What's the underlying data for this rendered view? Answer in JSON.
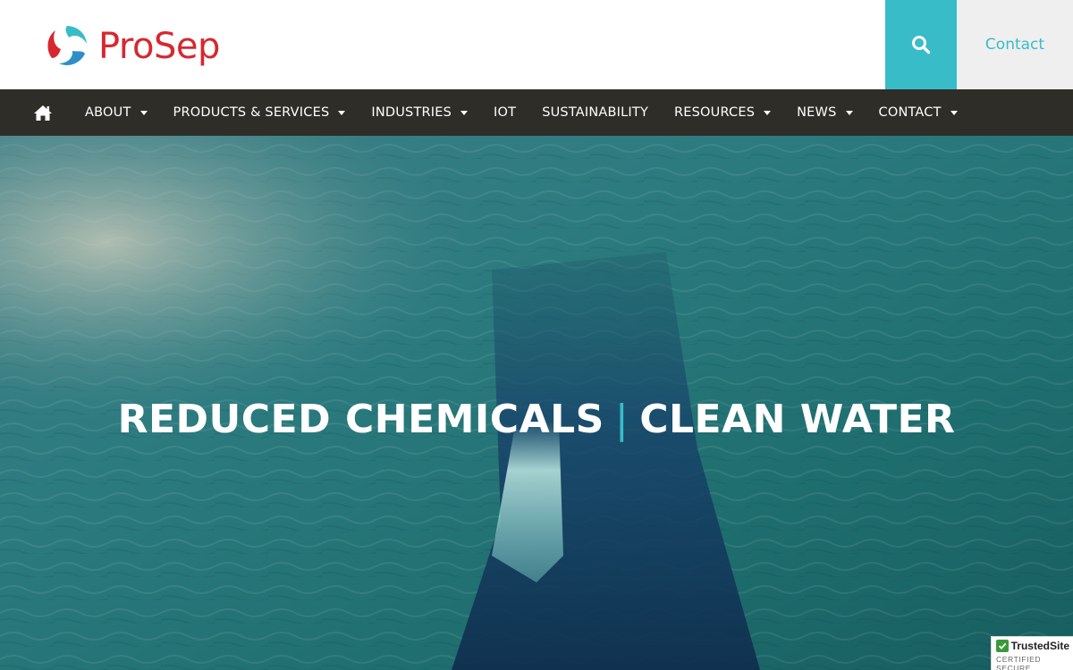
{
  "header": {
    "logo_text": "ProSep",
    "search_icon": "search-icon",
    "contact_label": "Contact"
  },
  "nav": {
    "home_icon": "home-icon",
    "items": [
      {
        "label": "ABOUT",
        "has_dropdown": true
      },
      {
        "label": "PRODUCTS & SERVICES",
        "has_dropdown": true
      },
      {
        "label": "INDUSTRIES",
        "has_dropdown": true
      },
      {
        "label": "IOT",
        "has_dropdown": false
      },
      {
        "label": "SUSTAINABILITY",
        "has_dropdown": false
      },
      {
        "label": "RESOURCES",
        "has_dropdown": true
      },
      {
        "label": "NEWS",
        "has_dropdown": true
      },
      {
        "label": "CONTACT",
        "has_dropdown": true
      }
    ]
  },
  "hero": {
    "title_left": "REDUCED CHEMICALS",
    "separator": "|",
    "title_right": "CLEAN WATER"
  },
  "badge": {
    "name": "TrustedSite",
    "subtitle": "CERTIFIED SECURE"
  },
  "colors": {
    "brand_red": "#d7282f",
    "accent_teal": "#38bcc8",
    "nav_bg": "#2f2d28"
  }
}
